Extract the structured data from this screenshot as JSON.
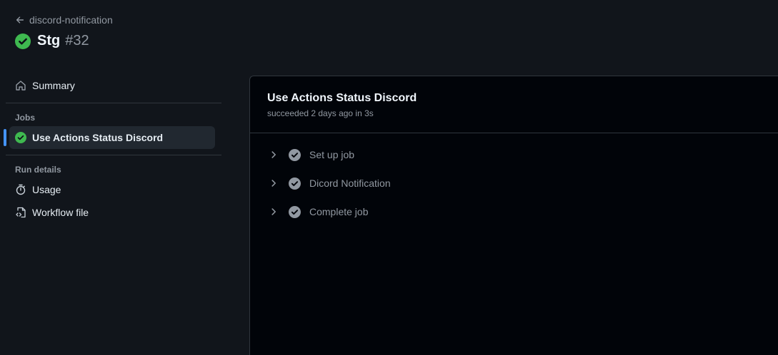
{
  "header": {
    "back_label": "discord-notification",
    "title": "Stg",
    "run_number": "#32"
  },
  "sidebar": {
    "summary_label": "Summary",
    "jobs_heading": "Jobs",
    "jobs": [
      {
        "label": "Use Actions Status Discord",
        "status": "success"
      }
    ],
    "run_details_heading": "Run details",
    "run_details": [
      {
        "label": "Usage",
        "icon": "stopwatch-icon"
      },
      {
        "label": "Workflow file",
        "icon": "file-code-icon"
      }
    ]
  },
  "job": {
    "title": "Use Actions Status Discord",
    "subtitle": "succeeded 2 days ago in 3s",
    "steps": [
      {
        "label": "Set up job",
        "status": "success"
      },
      {
        "label": "Dicord Notification",
        "status": "success"
      },
      {
        "label": "Complete job",
        "status": "success"
      }
    ]
  },
  "colors": {
    "success": "#3fb950",
    "accent": "#4493f8",
    "muted": "#9198a1"
  }
}
